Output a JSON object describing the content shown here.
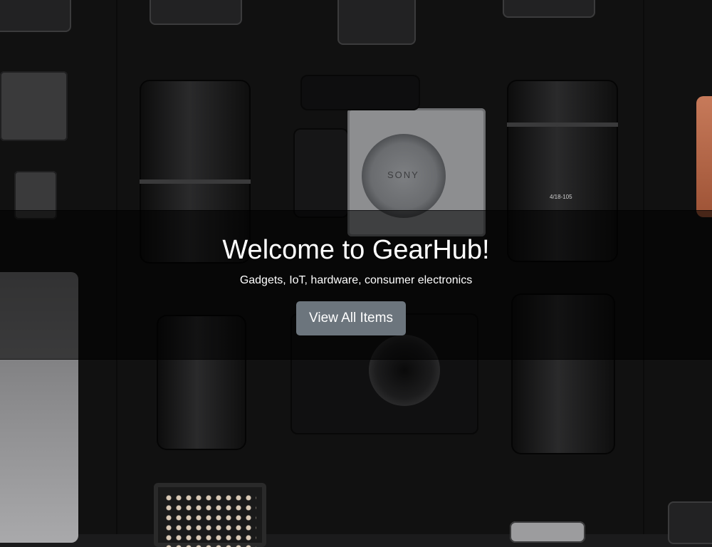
{
  "hero": {
    "title": "Welcome to GearHub!",
    "subtitle": "Gadgets, IoT, hardware, consumer electronics",
    "cta_label": "View All Items"
  },
  "background": {
    "lens_labels": [
      "4/18-105"
    ],
    "mount_label": "SONY"
  },
  "colors": {
    "overlay": "rgba(0,0,0,0.55)",
    "button_bg": "#6c757d",
    "text": "#ffffff"
  }
}
